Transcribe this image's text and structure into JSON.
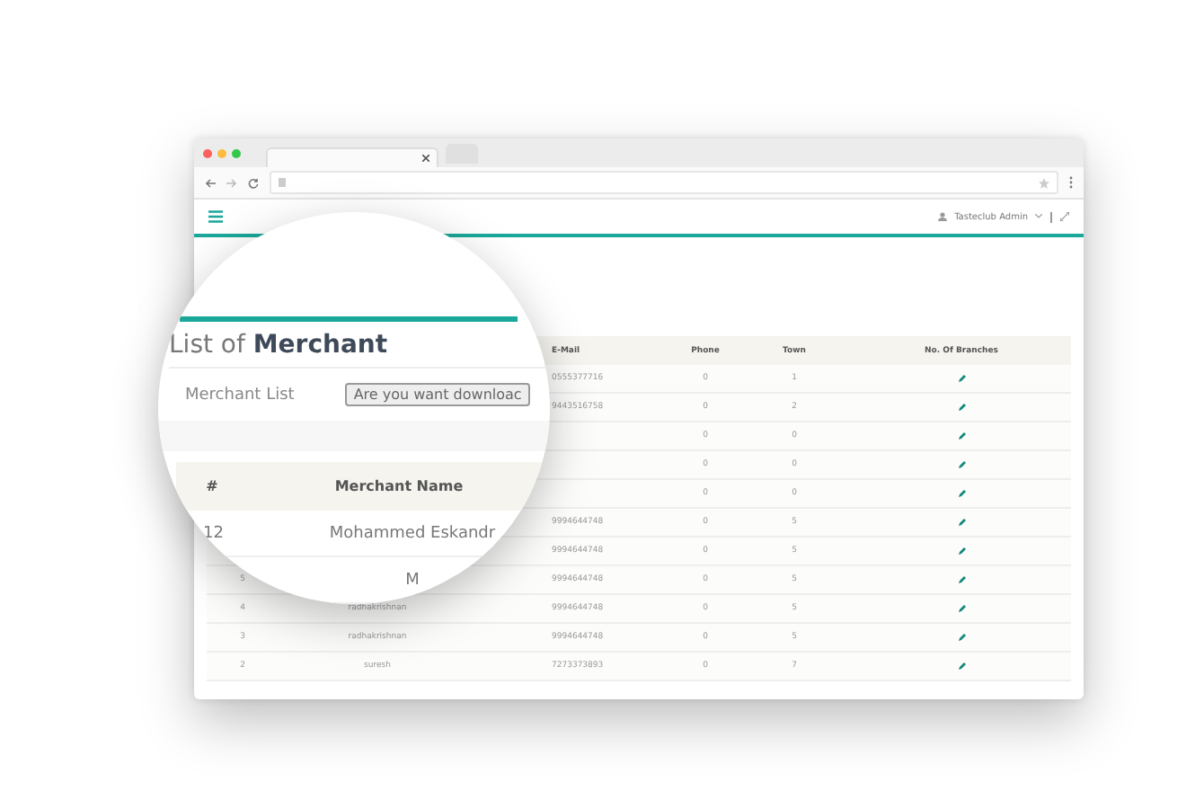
{
  "browser": {
    "tabs": [
      {
        "selected": true
      },
      {
        "selected": false
      }
    ]
  },
  "header": {
    "user": "Tasteclub Admin"
  },
  "table": {
    "columns": {
      "email": "E-Mail",
      "phone": "Phone",
      "town": "Town",
      "branches": "No. Of Branches"
    },
    "rows": [
      {
        "email": "0555377716",
        "phone": "0",
        "town": "1"
      },
      {
        "email": "9443516758",
        "phone": "0",
        "town": "2"
      },
      {
        "phone": "0",
        "town": "0"
      },
      {
        "phone": "0",
        "town": "0"
      },
      {
        "phone": "0",
        "town": "0"
      },
      {
        "email": "9994644748",
        "phone": "0",
        "town": "5"
      },
      {
        "email": "9994644748",
        "phone": "0",
        "town": "5"
      },
      {
        "number": "5",
        "email": "9994644748",
        "phone": "0",
        "town": "5"
      },
      {
        "number": "4",
        "name": "radhakrishnan",
        "email": "9994644748",
        "phone": "0",
        "town": "5"
      },
      {
        "number": "3",
        "name": "radhakrishnan",
        "email": "9994644748",
        "phone": "0",
        "town": "5"
      },
      {
        "number": "2",
        "name": "suresh",
        "email": "7273373893",
        "phone": "0",
        "town": "7"
      }
    ]
  },
  "magnifier": {
    "title": "List of **Merchant**",
    "subtitle": "Merchant List",
    "download_button": "Are you want downloac",
    "columns": [
      "#",
      "Merchant Name"
    ],
    "rows": [
      {
        "number": "12",
        "name": "Mohammed Eskandr"
      },
      {
        "name": "M"
      }
    ]
  }
}
